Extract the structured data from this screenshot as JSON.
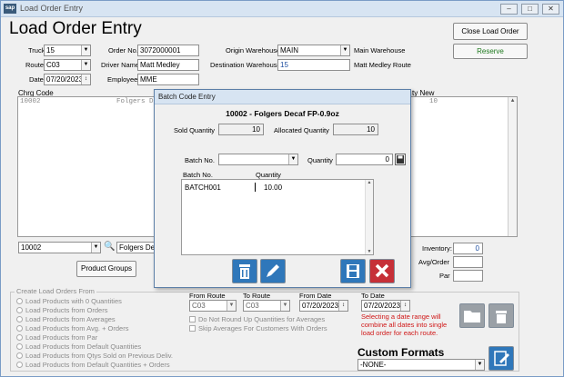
{
  "window": {
    "app_icon": "sap",
    "title": "Load Order Entry"
  },
  "heading": "Load Order Entry",
  "header": {
    "truck_label": "Truck",
    "truck_value": "15",
    "route_label": "Route",
    "route_value": "C03",
    "date_label": "Date",
    "date_value": "07/20/2023",
    "order_no_label": "Order No.",
    "order_no_value": "3072000001",
    "driver_label": "Driver Name",
    "driver_value": "Matt Medley",
    "employee_label": "Employee",
    "employee_value": "MME",
    "origin_label": "Origin Warehouse",
    "origin_value": "MAIN",
    "origin_desc": "Main Warehouse",
    "dest_label": "Destination Warehouse",
    "dest_value": "15",
    "dest_desc": "Matt Medley Route"
  },
  "buttons": {
    "close_load_order": "Close Load Order",
    "reserve": "Reserve",
    "product_groups": "Product Groups"
  },
  "grid": {
    "col_chrg_code": "Chrg Code",
    "col_qty_new": "ty New",
    "rows": [
      {
        "code": "10002",
        "desc": "Folgers De",
        "qty": "10"
      }
    ]
  },
  "product_select": {
    "code": "10002",
    "desc": "Folgers De"
  },
  "right_panel": {
    "inventory_label": "Inventory:",
    "inventory_value": "0",
    "avg_order_label": "Avg/Order",
    "par_label": "Par"
  },
  "create_from": {
    "legend": "Create Load Orders From",
    "options": [
      "Load Products with 0 Quantities",
      "Load Products from Orders",
      "Load Products from Averages",
      "Load Products from Avg. + Orders",
      "Load Products from Par",
      "Load Products from Default Quantities",
      "Load Products from Qtys Sold on Previous Deliv.",
      "Load Products from Default Quantities + Orders"
    ]
  },
  "route_range": {
    "from_route_label": "From Route",
    "from_route_value": "C03",
    "to_route_label": "To Route",
    "to_route_value": "C03",
    "from_date_label": "From Date",
    "from_date_value": "07/20/2023",
    "to_date_label": "To Date",
    "to_date_value": "07/20/2023",
    "no_round_label": "Do Not Round Up Quantities for Averages",
    "skip_avg_label": "Skip Averages For Customers With Orders",
    "date_note": "Selecting a date range will combine all dates into single load order for each route."
  },
  "custom_formats": {
    "label": "Custom Formats",
    "value": "-NONE-"
  },
  "modal": {
    "title": "Batch Code Entry",
    "product": "10002 - Folgers Decaf FP-0.9oz",
    "sold_qty_label": "Sold Quantity",
    "sold_qty_value": "10",
    "alloc_qty_label": "Allocated Quantity",
    "alloc_qty_value": "10",
    "batch_no_label": "Batch No.",
    "batch_no_value": "",
    "quantity_label": "Quantity",
    "quantity_value": "0",
    "list_col_batch": "Batch No.",
    "list_col_qty": "Quantity",
    "list_rows": [
      {
        "batch": "BATCH001",
        "qty": "10.00"
      }
    ]
  },
  "colors": {
    "accent": "#2f77ba",
    "danger": "#c63038",
    "note": "#d01818",
    "reserve_text": "#1f7a1f",
    "dest_text": "#1f4fa0"
  }
}
